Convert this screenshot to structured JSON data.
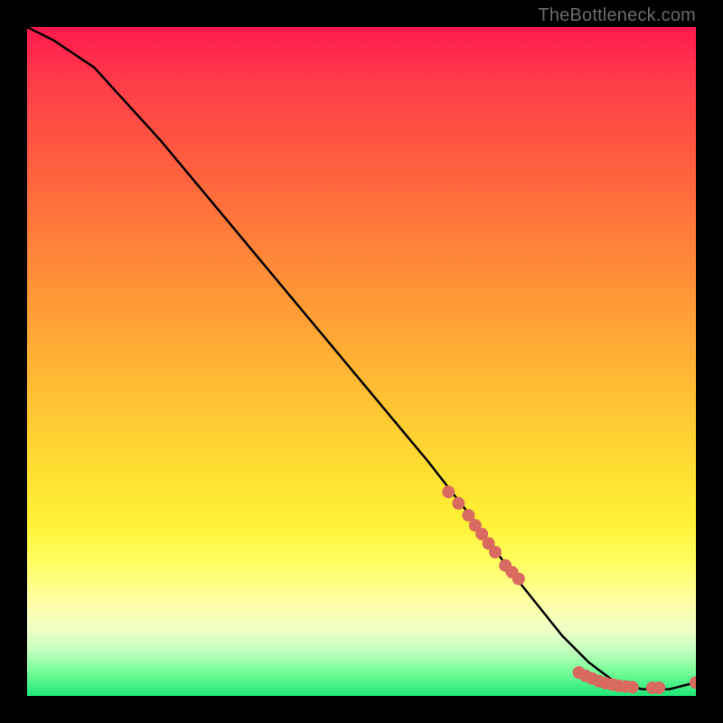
{
  "watermark": "TheBottleneck.com",
  "chart_data": {
    "type": "line",
    "title": "",
    "xlabel": "",
    "ylabel": "",
    "xlim": [
      0,
      100
    ],
    "ylim": [
      0,
      100
    ],
    "grid": false,
    "series": [
      {
        "name": "curve",
        "style": "line",
        "color": "#000000",
        "x": [
          0,
          4,
          10,
          20,
          30,
          40,
          50,
          60,
          67,
          72,
          76,
          80,
          84,
          88,
          92,
          96,
          100
        ],
        "values": [
          100,
          98,
          94,
          83,
          71,
          59,
          47,
          35,
          26,
          19,
          14,
          9,
          5,
          2,
          1,
          1,
          2
        ]
      },
      {
        "name": "dots",
        "style": "scatter",
        "color": "#d86a5f",
        "x": [
          63,
          64.5,
          66,
          67,
          68,
          69,
          70,
          71.5,
          72.5,
          73.5,
          82.5,
          83.5,
          84.5,
          85.5,
          86.5,
          87.5,
          88.5,
          89.5,
          90.5,
          93.5,
          94.5,
          100
        ],
        "values": [
          30.5,
          28.8,
          27.0,
          25.5,
          24.2,
          22.8,
          21.5,
          19.5,
          18.5,
          17.5,
          3.5,
          3.0,
          2.6,
          2.2,
          1.9,
          1.7,
          1.5,
          1.4,
          1.3,
          1.2,
          1.2,
          2.0
        ]
      }
    ],
    "annotations": []
  }
}
